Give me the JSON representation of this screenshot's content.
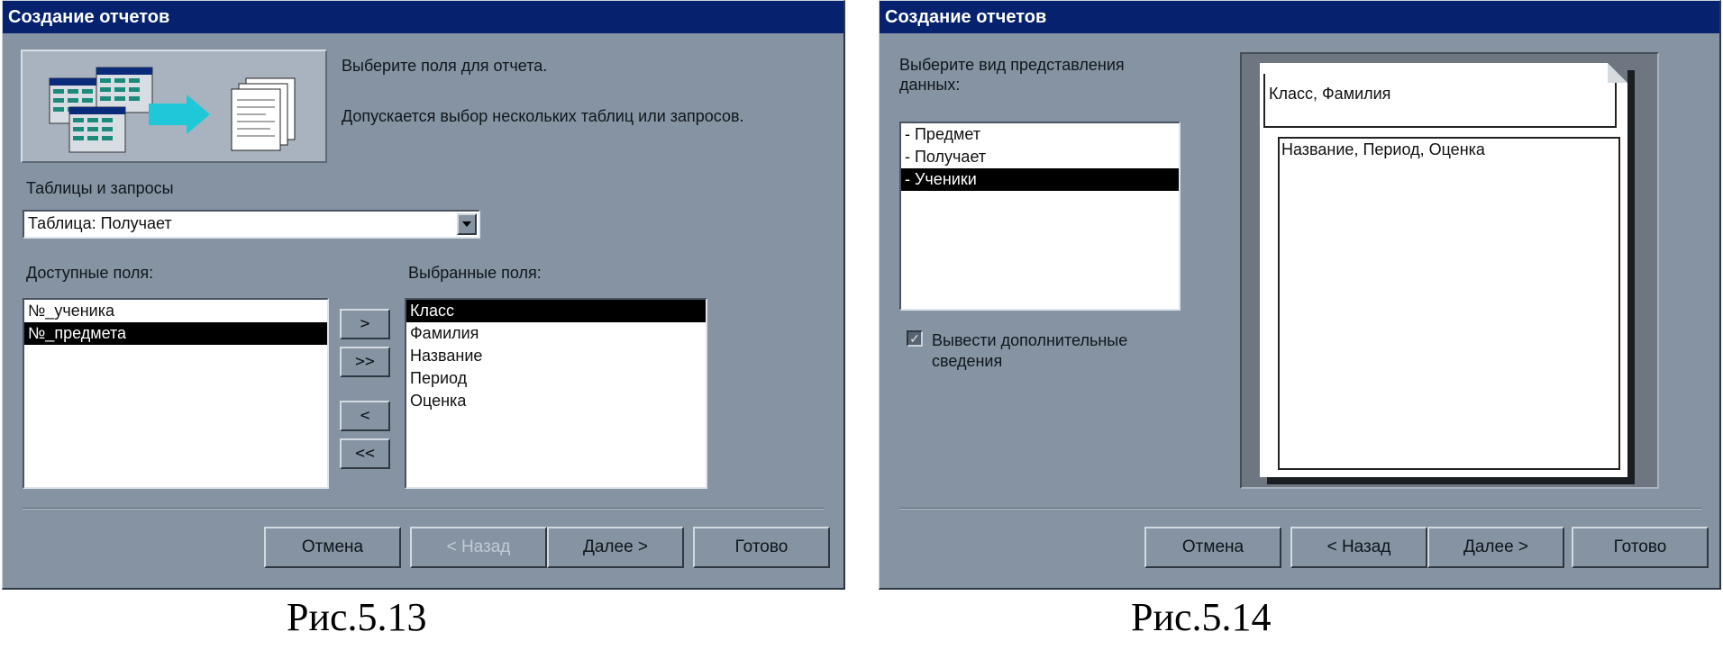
{
  "dialog1": {
    "title": "Создание отчетов",
    "instruction1": "Выберите поля для отчета.",
    "instruction2": "Допускается выбор нескольких таблиц или запросов.",
    "tables_label": "Таблицы и запросы",
    "tables_value": "Таблица: Получает",
    "available_label": "Доступные поля:",
    "available_fields": [
      "№_ученика",
      "№_предмета"
    ],
    "available_selected_index": 1,
    "selected_label": "Выбранные поля:",
    "selected_fields": [
      "Класс",
      "Фамилия",
      "Название",
      "Период",
      "Оценка"
    ],
    "selected_selected_index": 0,
    "move_one": ">",
    "move_all": ">>",
    "remove_one": "<",
    "remove_all": "<<",
    "buttons": {
      "cancel": "Отмена",
      "back": "< Назад",
      "next": "Далее >",
      "finish": "Готово"
    }
  },
  "dialog2": {
    "title": "Создание отчетов",
    "prompt": "Выберите вид представления данных:",
    "views": [
      "- Предмет",
      "- Получает",
      "- Ученики"
    ],
    "views_selected_index": 2,
    "extra_info": "Вывести дополнительные сведения",
    "preview_header": "Класс, Фамилия",
    "preview_detail": "Название, Период, Оценка",
    "buttons": {
      "cancel": "Отмена",
      "back": "< Назад",
      "next": "Далее >",
      "finish": "Готово"
    }
  },
  "captions": {
    "left": "Рис.5.13",
    "right": "Рис.5.14"
  },
  "colors": {
    "dialog_bg": "#8593a2",
    "titlebar": "#06226e",
    "selection": "#000000",
    "accent_arrow": "#1ec8d8"
  }
}
